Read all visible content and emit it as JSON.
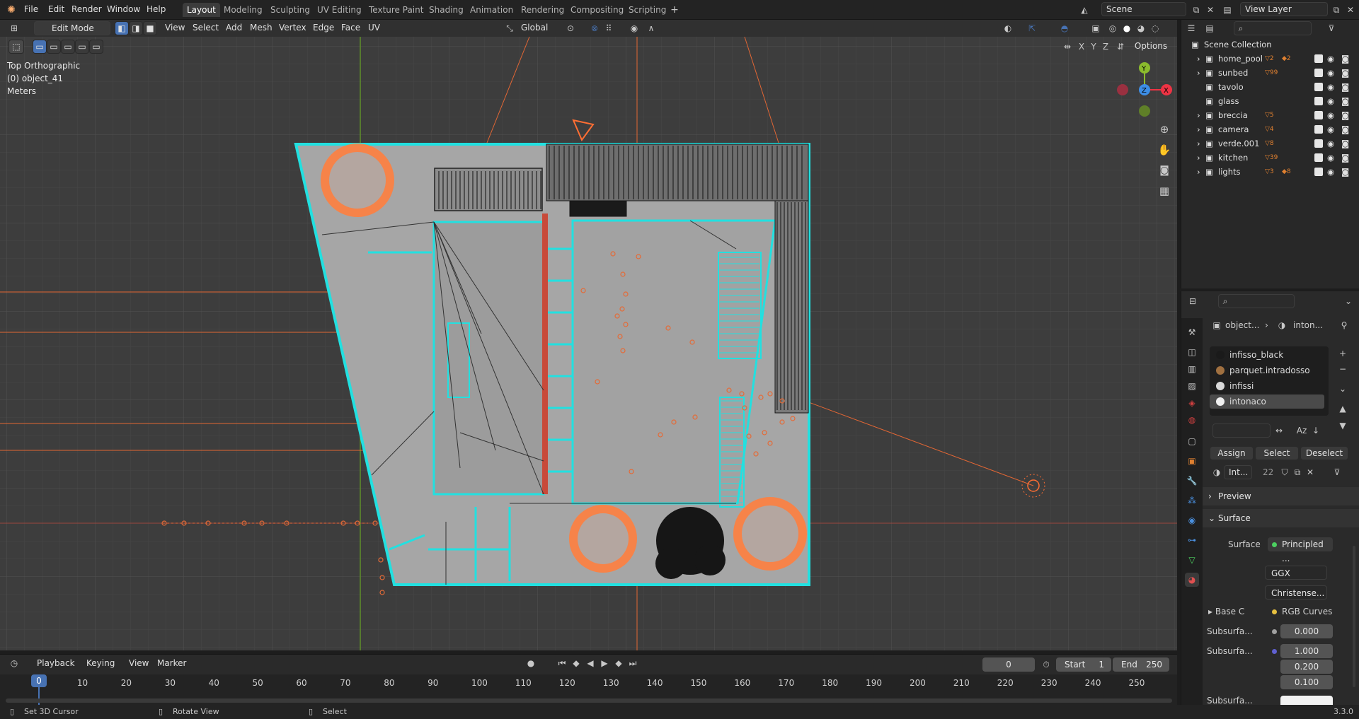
{
  "app": {
    "version": "3.3.0"
  },
  "menu": [
    "File",
    "Edit",
    "Render",
    "Window",
    "Help"
  ],
  "workspaces": [
    "Layout",
    "Modeling",
    "Sculpting",
    "UV Editing",
    "Texture Paint",
    "Shading",
    "Animation",
    "Rendering",
    "Compositing",
    "Scripting"
  ],
  "active_workspace": "Layout",
  "scene_field": "Scene",
  "view_layer_field": "View Layer",
  "viewport_header": {
    "mode": "Edit Mode",
    "menus": [
      "View",
      "Select",
      "Add",
      "Mesh",
      "Vertex",
      "Edge",
      "Face",
      "UV"
    ],
    "transform_orientation": "Global",
    "options_label": "Options",
    "axis_toggles": [
      "X",
      "Y",
      "Z"
    ]
  },
  "viewport_overlay": {
    "view_name": "Top Orthographic",
    "object_name": "(0) object_41",
    "units": "Meters",
    "gizmo": {
      "x": "X",
      "y": "Y",
      "z": "Z"
    }
  },
  "outliner": {
    "root": "Scene Collection",
    "items": [
      {
        "name": "home_pool",
        "badge": "2",
        "badge2": "2"
      },
      {
        "name": "sunbed",
        "badge": "99"
      },
      {
        "name": "tavolo"
      },
      {
        "name": "glass"
      },
      {
        "name": "breccia",
        "badge": "5"
      },
      {
        "name": "camera",
        "badge": "4"
      },
      {
        "name": "verde.001",
        "badge": "8"
      },
      {
        "name": "kitchen",
        "badge": "39"
      },
      {
        "name": "lights",
        "badge": "3",
        "badge2": "8"
      }
    ]
  },
  "properties": {
    "breadcrumb": {
      "object": "object...",
      "material": "inton..."
    },
    "material_slots": [
      "infisso_black",
      "parquet.intradosso",
      "infissi",
      "intonaco"
    ],
    "slot_colors": [
      "#1a1a1a",
      "#a07040",
      "#d8d8d8",
      "#f0f0f0"
    ],
    "selected_slot": "intonaco",
    "buttons": {
      "assign": "Assign",
      "select": "Select",
      "deselect": "Deselect"
    },
    "material_name": "Int...",
    "user_count": "22",
    "panels": {
      "preview": "Preview",
      "surface": "Surface"
    },
    "surface": {
      "surface_label": "Surface",
      "surface_value": "Principled ...",
      "distribution": "GGX",
      "subsurface_method": "Christense...",
      "base_color_label": "Base C",
      "base_color_value": "RGB Curves",
      "subsurface_label": "Subsurfa...",
      "subsurface_value": "0.000",
      "subsurface_radius_label": "Subsurfa...",
      "subsurface_radius": [
        "1.000",
        "0.200",
        "0.100"
      ],
      "subsurface_color_label": "Subsurfa..."
    }
  },
  "timeline": {
    "menus": [
      "Playback",
      "Keying",
      "View",
      "Marker"
    ],
    "current_frame": "0",
    "start_label": "Start",
    "start": "1",
    "end_label": "End",
    "end": "250",
    "ticks": [
      "0",
      "10",
      "20",
      "30",
      "40",
      "50",
      "60",
      "70",
      "80",
      "90",
      "100",
      "110",
      "120",
      "130",
      "140",
      "150",
      "160",
      "170",
      "180",
      "190",
      "200",
      "210",
      "220",
      "230",
      "240",
      "250"
    ]
  },
  "statusbar": {
    "left": "Set 3D Cursor",
    "middle": "Rotate View",
    "right": "Select",
    "version": "3.3.0"
  },
  "colors": {
    "accent": "#4772b3",
    "select": "#00e5ff",
    "light": "#ff6e33",
    "y_axis": "#8bbb2d",
    "x_axis": "#ee3344",
    "z_axis": "#3d8ee6"
  }
}
